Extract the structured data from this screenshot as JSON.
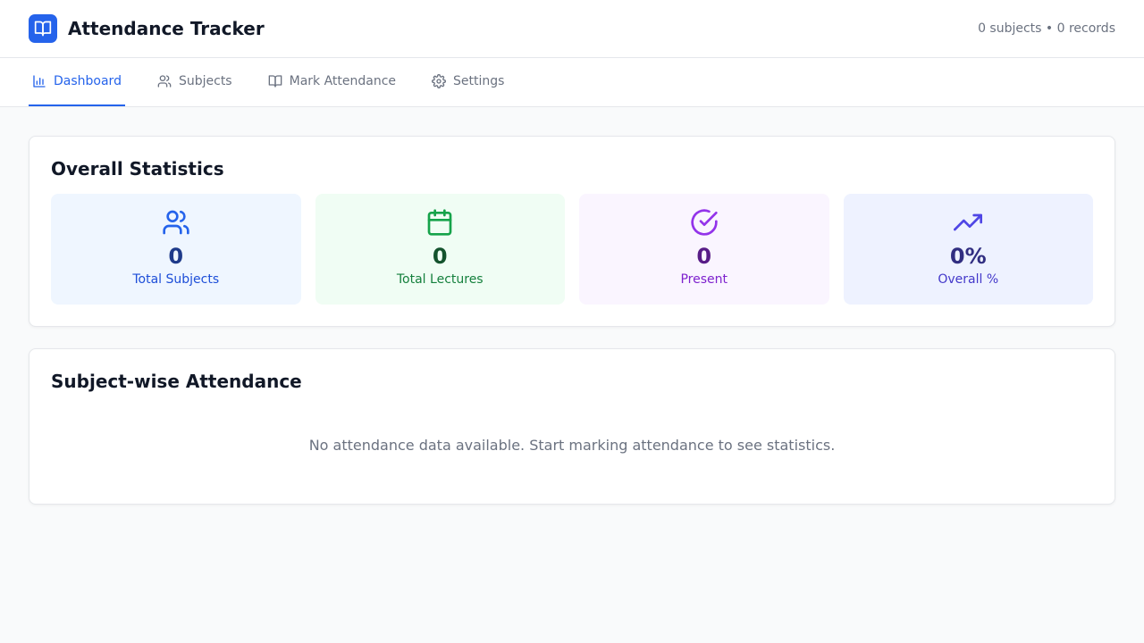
{
  "header": {
    "title": "Attendance Tracker",
    "logo_icon": "book-open-icon",
    "summary": "0 subjects • 0 records"
  },
  "tabs": [
    {
      "label": "Dashboard",
      "icon": "bar-chart-icon",
      "active": true
    },
    {
      "label": "Subjects",
      "icon": "users-icon",
      "active": false
    },
    {
      "label": "Mark Attendance",
      "icon": "book-open-icon",
      "active": false
    },
    {
      "label": "Settings",
      "icon": "gear-icon",
      "active": false
    }
  ],
  "overall": {
    "title": "Overall Statistics",
    "stats": [
      {
        "value": "0",
        "label": "Total Subjects",
        "icon": "users-icon",
        "color": "#2563eb"
      },
      {
        "value": "0",
        "label": "Total Lectures",
        "icon": "calendar-icon",
        "color": "#16a34a"
      },
      {
        "value": "0",
        "label": "Present",
        "icon": "check-circle-icon",
        "color": "#9333ea"
      },
      {
        "value": "0%",
        "label": "Overall %",
        "icon": "trending-up-icon",
        "color": "#4f46e5"
      }
    ]
  },
  "subject_wise": {
    "title": "Subject-wise Attendance",
    "empty_message": "No attendance data available. Start marking attendance to see statistics."
  },
  "colors": {
    "accent": "#2563eb",
    "background": "#f9fafb"
  }
}
